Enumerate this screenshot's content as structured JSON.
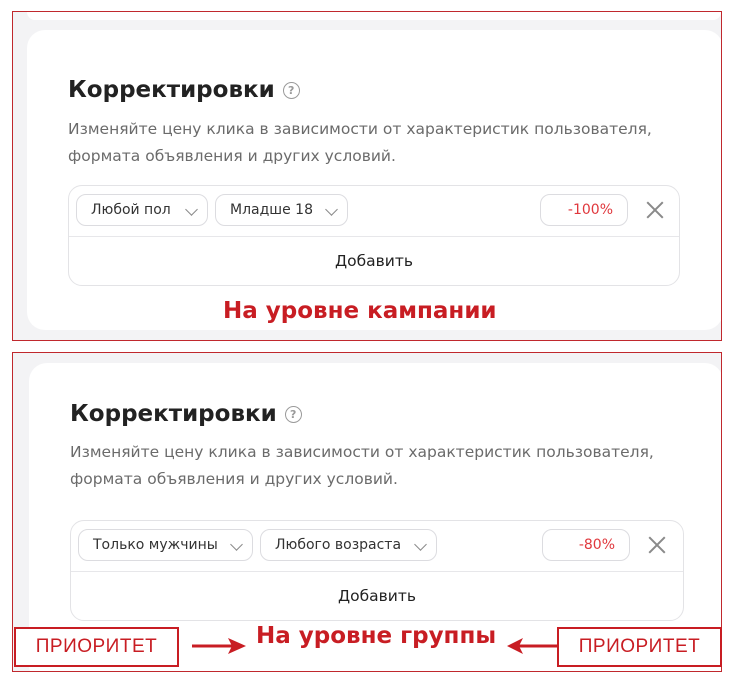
{
  "panel_top": {
    "title": "Корректировки",
    "help_glyph": "?",
    "description_line1": "Изменяйте цену клика в зависимости от характеристик пользователя,",
    "description_line2": "формата объявления и других условий.",
    "gender_chip": "Любой пол",
    "age_chip": "Младше 18",
    "percent": "-100%",
    "add_label": "Добавить",
    "level_label": "На уровне кампании"
  },
  "panel_bottom": {
    "title": "Корректировки",
    "help_glyph": "?",
    "description_line1": "Изменяйте цену клика в зависимости от характеристик пользователя,",
    "description_line2": "формата объявления и других условий.",
    "gender_chip": "Только мужчины",
    "age_chip": "Любого возраста",
    "percent": "-80%",
    "add_label": "Добавить",
    "level_label": "На уровне группы"
  },
  "annotations": {
    "priority_left": "ПРИОРИТЕТ",
    "priority_right": "ПРИОРИТЕТ"
  },
  "colors": {
    "annotation_red": "#c81d23",
    "percent_red": "#e0383d"
  },
  "icons": {
    "help": "question-circle-icon",
    "chevron": "chevron-down-icon",
    "close": "close-icon",
    "arrow": "arrow-right-icon"
  }
}
